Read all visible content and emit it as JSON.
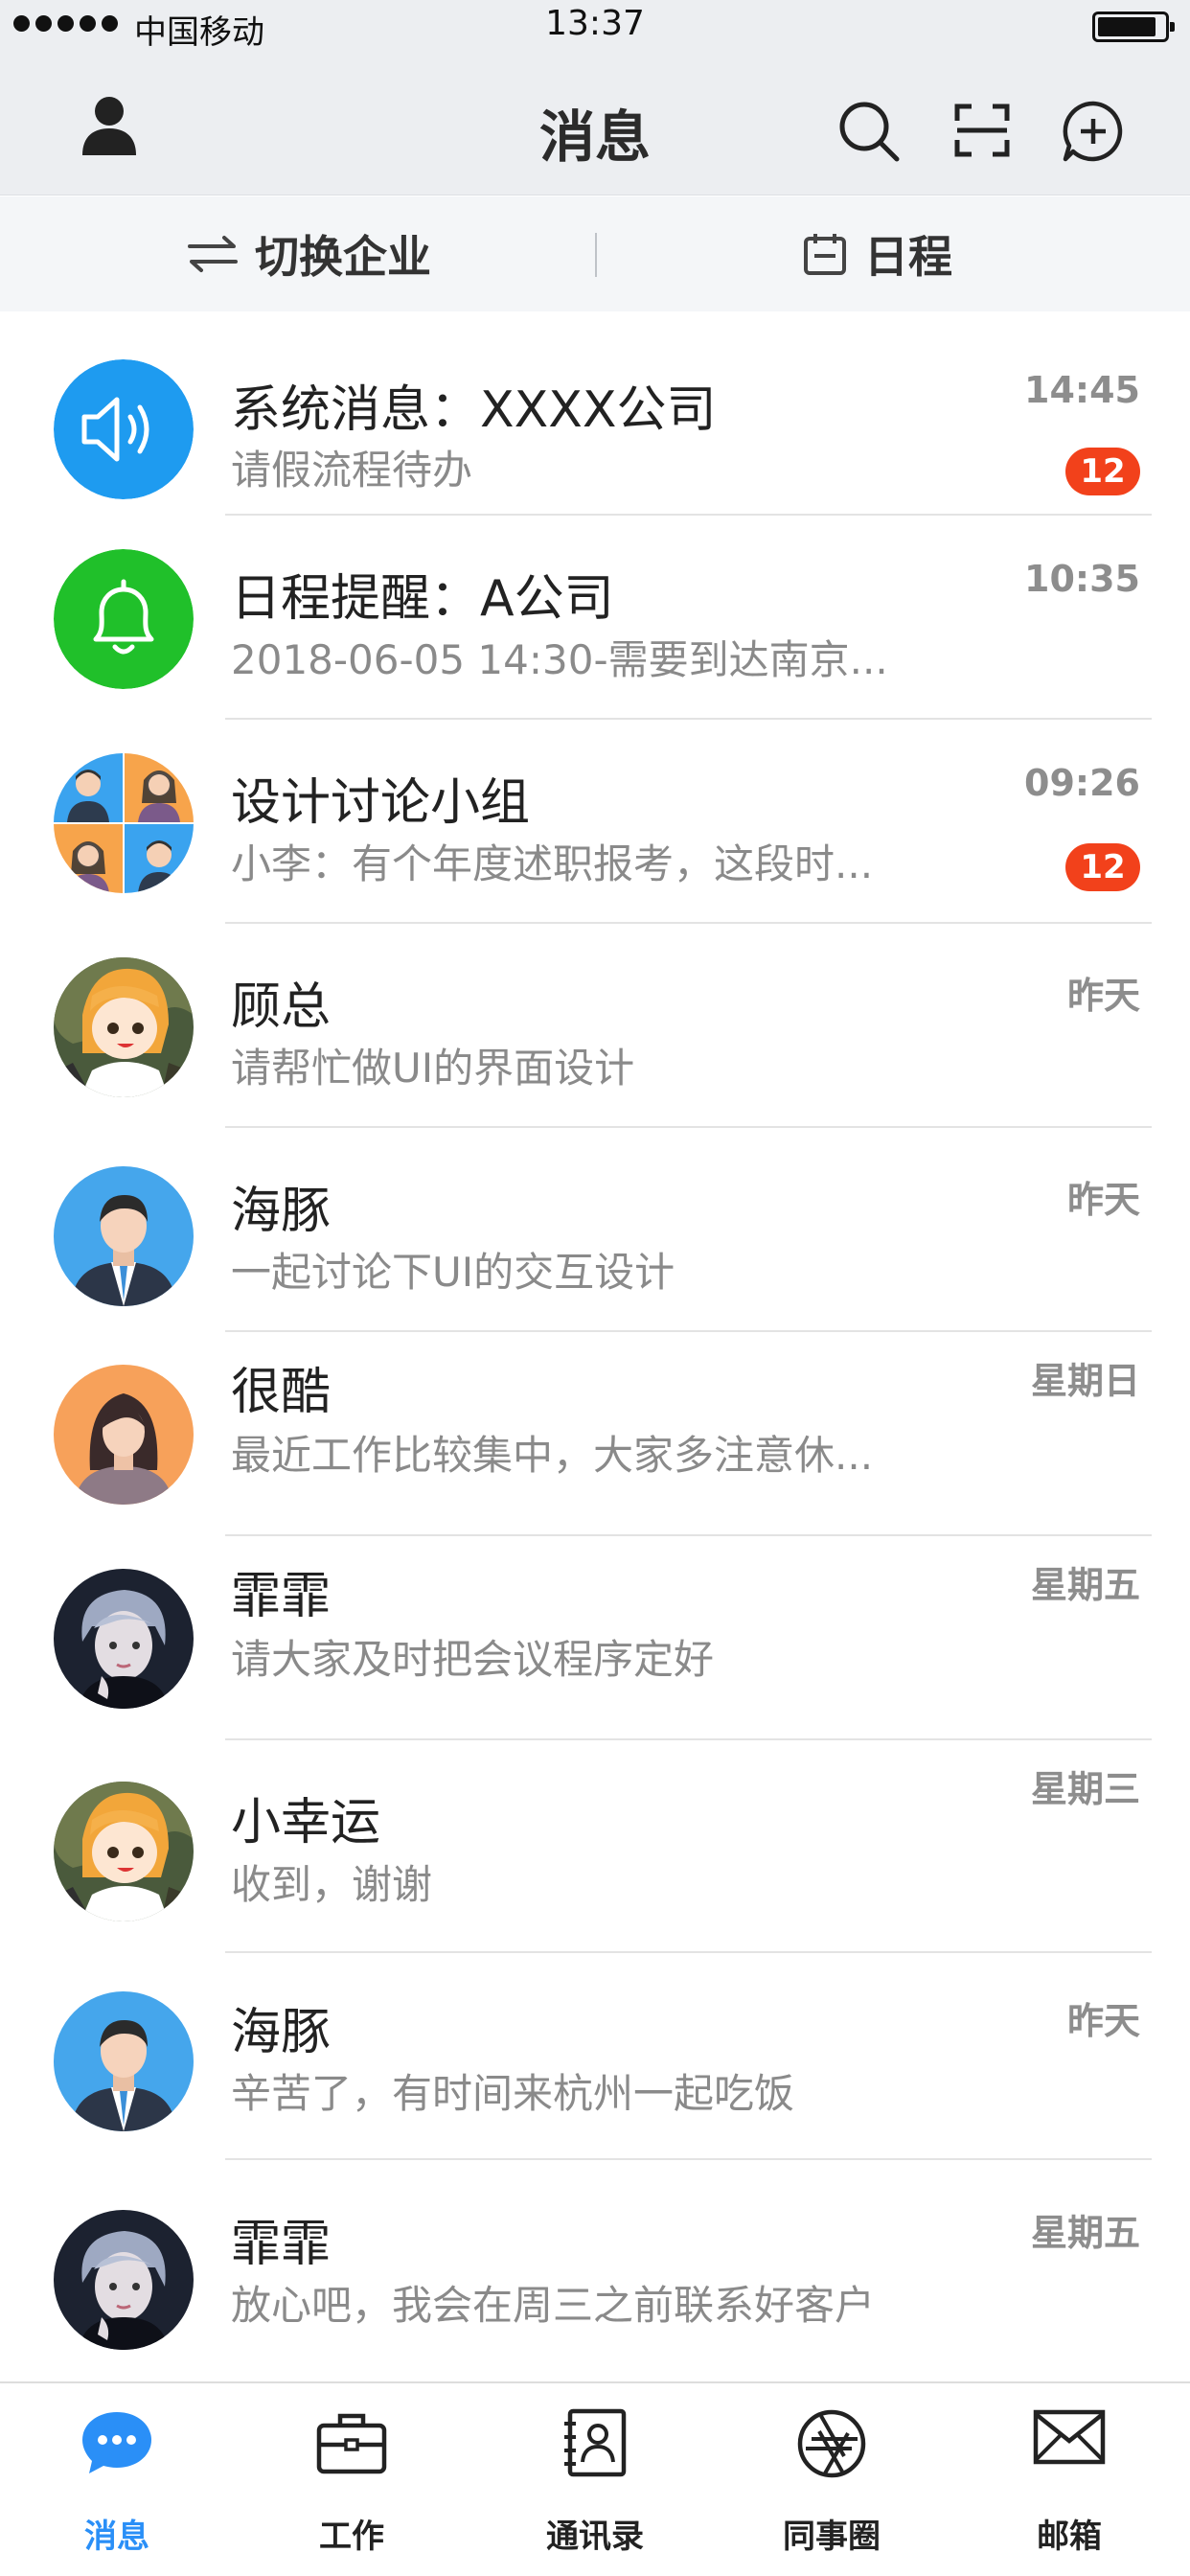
{
  "status_bar": {
    "carrier": "中国移动",
    "time": "13:37"
  },
  "header": {
    "title": "消息",
    "icons": [
      "user-icon",
      "search-icon",
      "scan-icon",
      "add-circle-icon"
    ]
  },
  "subbar": {
    "switch_label": "切换企业",
    "schedule_label": "日程"
  },
  "messages": [
    {
      "name": "系统消息：XXXX公司",
      "preview": "请假流程待办",
      "time": "14:45",
      "badge": "12",
      "avatar": "speaker-icon"
    },
    {
      "name": "日程提醒：A公司",
      "preview": "2018-06-05 14:30-需要到达南京...",
      "time": "10:35",
      "badge": "",
      "avatar": "bell-icon"
    },
    {
      "name": "设计讨论小组",
      "preview": "小李：有个年度述职报考，这段时...",
      "time": "09:26",
      "badge": "12",
      "avatar": "group-avatar"
    },
    {
      "name": "顾总",
      "preview": "请帮忙做UI的界面设计",
      "time": "昨天",
      "badge": "",
      "avatar": "anime-girl-avatar"
    },
    {
      "name": "海豚",
      "preview": "一起讨论下UI的交互设计",
      "time": "昨天",
      "badge": "",
      "avatar": "man-avatar"
    },
    {
      "name": "很酷",
      "preview": "最近工作比较集中，大家多注意休...",
      "time": "星期日",
      "badge": "",
      "avatar": "woman-avatar"
    },
    {
      "name": "霏霏",
      "preview": "请大家及时把会议程序定好",
      "time": "星期五",
      "badge": "",
      "avatar": "portrait-avatar"
    },
    {
      "name": "小幸运",
      "preview": "收到，谢谢",
      "time": "星期三",
      "badge": "",
      "avatar": "anime-girl-avatar"
    },
    {
      "name": "海豚",
      "preview": "辛苦了，有时间来杭州一起吃饭",
      "time": "昨天",
      "badge": "",
      "avatar": "man-avatar"
    },
    {
      "name": "霏霏",
      "preview": "放心吧，我会在周三之前联系好客户",
      "time": "星期五",
      "badge": "",
      "avatar": "portrait-avatar"
    }
  ],
  "tabbar": {
    "tabs": [
      {
        "label": "消息",
        "icon": "chat-bubble-icon",
        "active": true
      },
      {
        "label": "工作",
        "icon": "briefcase-icon",
        "active": false
      },
      {
        "label": "通讯录",
        "icon": "contacts-icon",
        "active": false
      },
      {
        "label": "同事圈",
        "icon": "aperture-icon",
        "active": false
      },
      {
        "label": "邮箱",
        "icon": "mail-icon",
        "active": false
      }
    ]
  },
  "colors": {
    "accent": "#2a8ff7",
    "badge": "#f2411b",
    "system_blue": "#1e9bf0",
    "reminder_green": "#20c02a"
  }
}
